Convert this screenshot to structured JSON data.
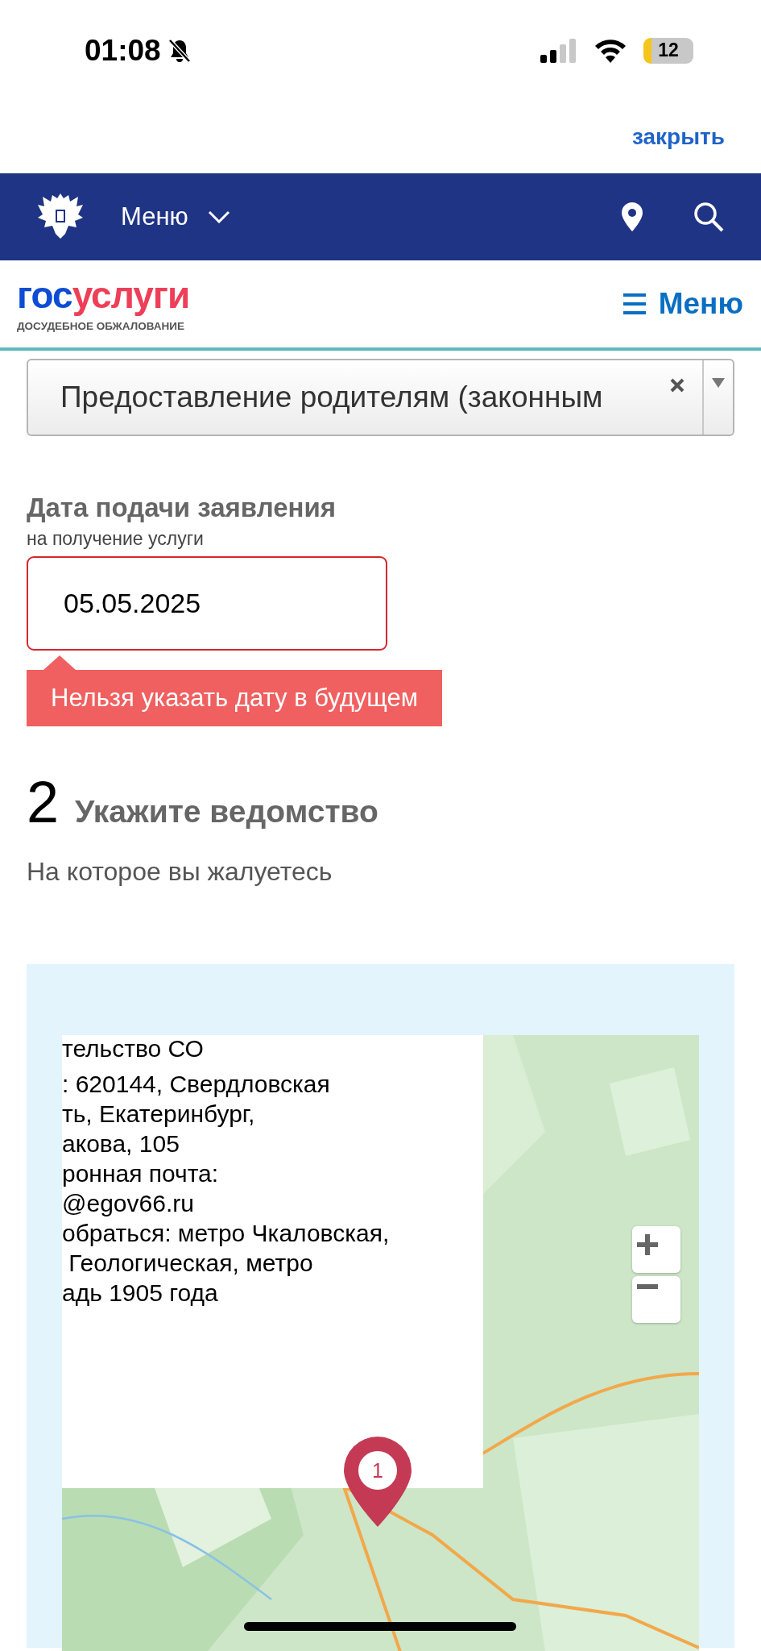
{
  "status_bar": {
    "time": "01:08",
    "silent": true,
    "battery": "12"
  },
  "close_link": "закрыть",
  "top_nav": {
    "menu": "Меню"
  },
  "site_header": {
    "logo": [
      {
        "text": "гос",
        "color": "#0d4cd3"
      },
      {
        "text": "услуги",
        "color": "#ee3f58"
      }
    ],
    "tagline": "ДОСУДЕБНОЕ ОБЖАЛОВАНИЕ",
    "menu": "Меню"
  },
  "service_select": {
    "value": "Предоставление родителям (законным"
  },
  "date_field": {
    "label": "Дата подачи заявления",
    "hint": "на получение услуги",
    "value": "05.05.2025",
    "invalid": true,
    "error": "Нельзя указать дату в будущем"
  },
  "step": {
    "number": "2",
    "title": "Укажите ведомство",
    "subtitle": "На которое вы жалуетесь"
  },
  "map": {
    "kind": "picture",
    "balloon": {
      "title": "тельство СО",
      "lines": [
        ": 620144, Свердловская",
        "ть, Екатеринбург,",
        "акова, 105",
        "ронная почта:",
        "@egov66.ru",
        "обраться: метро Чкаловская,",
        " Геологическая, метро",
        "адь 1905 года"
      ]
    },
    "marker": "1"
  }
}
